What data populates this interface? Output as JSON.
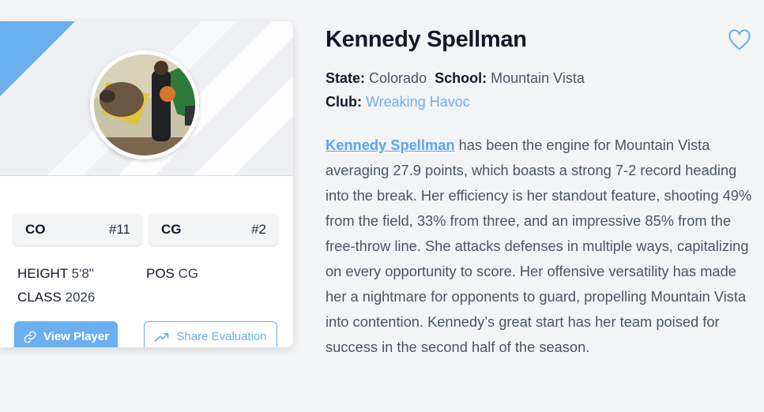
{
  "player": {
    "name": "Kennedy Spellman",
    "state_label": "State:",
    "state": "Colorado",
    "school_label": "School:",
    "school": "Mountain Vista",
    "club_label": "Club:",
    "club": "Wreaking Havoc"
  },
  "card": {
    "badge1": {
      "left": "CO",
      "right": "#11"
    },
    "badge2": {
      "left": "CG",
      "right": "#2"
    },
    "height_label": "HEIGHT",
    "height": "5'8\"",
    "pos_label": "POS",
    "pos": "CG",
    "class_label": "CLASS",
    "class": "2026",
    "view_button": "View Player",
    "share_button": "Share Evaluation"
  },
  "bio": {
    "link": "Kennedy Spellman",
    "text": " has been the engine for Mountain Vista averaging 27.9 points, which boasts a strong 7-2 record heading into the break. Her efficiency is her standout feature, shooting 49% from the field, 33% from three, and an impressive 85% from the free-throw line. She attacks defenses in multiple ways, capitalizing on every opportunity to score. Her offensive versatility has made her a nightmare for opponents to guard, propelling Mountain Vista into contention. Kennedy’s great start has her team poised for success in the second half of the season."
  },
  "icons": {
    "favorite": "heart-outline-icon",
    "view": "link-icon",
    "share": "trending-up-icon"
  },
  "colors": {
    "accent": "#6aaff0",
    "background": "#f3f4f6"
  }
}
